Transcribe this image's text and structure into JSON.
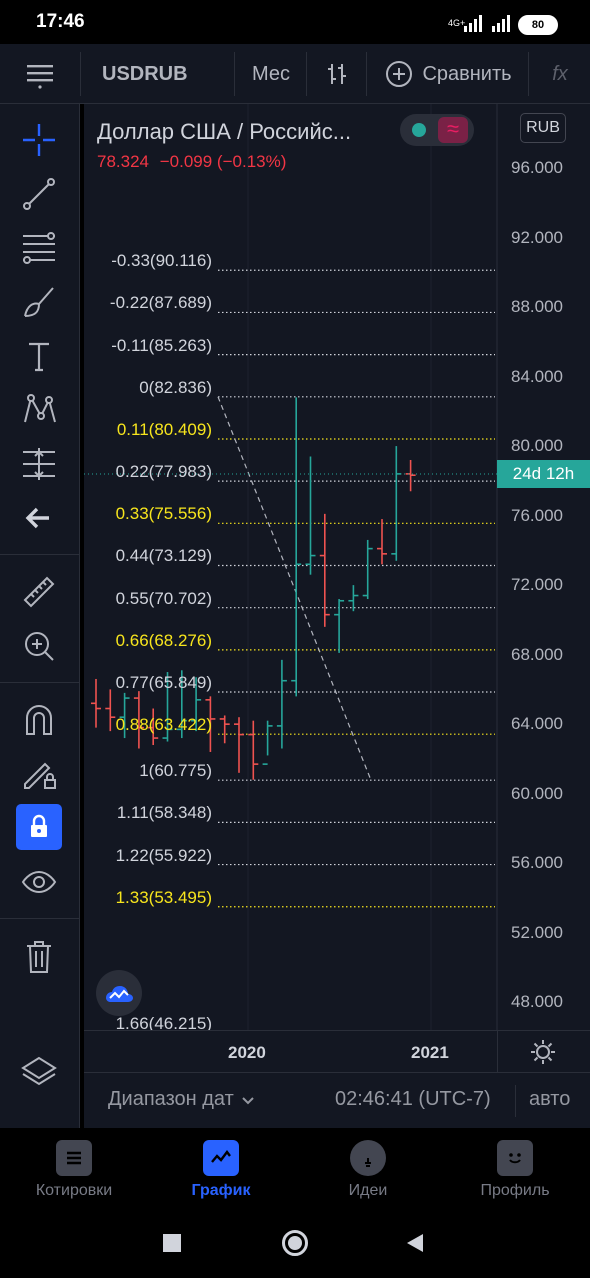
{
  "status_bar": {
    "time": "17:46",
    "network": "4G+",
    "battery": "80"
  },
  "toolbar": {
    "symbol": "USDRUB",
    "interval": "Мес",
    "compare_label": "Сравнить",
    "fx": "fx"
  },
  "chart_header": {
    "title": "Доллар США / Российс...",
    "price": "78.324",
    "change": "−0.099 (−0.13%)",
    "currency": "RUB"
  },
  "price_axis": [
    "96.000",
    "92.000",
    "88.000",
    "84.000",
    "80.000",
    "76.000",
    "72.000",
    "68.000",
    "64.000",
    "60.000",
    "56.000",
    "52.000",
    "48.000"
  ],
  "countdown": "24d 12h",
  "time_axis": [
    "2020",
    "2021"
  ],
  "fib_levels": [
    {
      "label": "-0.33(90.116)",
      "color": "#d1d4dc",
      "y": 90.116
    },
    {
      "label": "-0.22(87.689)",
      "color": "#d1d4dc",
      "y": 87.689
    },
    {
      "label": "-0.11(85.263)",
      "color": "#d1d4dc",
      "y": 85.263
    },
    {
      "label": "0(82.836)",
      "color": "#d1d4dc",
      "y": 82.836
    },
    {
      "label": "0.11(80.409)",
      "color": "#f7e51d",
      "y": 80.409
    },
    {
      "label": "0.22(77.983)",
      "color": "#d1d4dc",
      "y": 77.983
    },
    {
      "label": "0.33(75.556)",
      "color": "#f7e51d",
      "y": 75.556
    },
    {
      "label": "0.44(73.129)",
      "color": "#d1d4dc",
      "y": 73.129
    },
    {
      "label": "0.55(70.702)",
      "color": "#d1d4dc",
      "y": 70.702
    },
    {
      "label": "0.66(68.276)",
      "color": "#f7e51d",
      "y": 68.276
    },
    {
      "label": "0.77(65.849)",
      "color": "#d1d4dc",
      "y": 65.849
    },
    {
      "label": "0.88(63.422)",
      "color": "#f7e51d",
      "y": 63.422
    },
    {
      "label": "1(60.775)",
      "color": "#d1d4dc",
      "y": 60.775
    },
    {
      "label": "1.11(58.348)",
      "color": "#d1d4dc",
      "y": 58.348
    },
    {
      "label": "1.22(55.922)",
      "color": "#d1d4dc",
      "y": 55.922
    },
    {
      "label": "1.33(53.495)",
      "color": "#f7e51d",
      "y": 53.495
    },
    {
      "label": "1.66(46.215)",
      "color": "#d1d4dc",
      "y": 46.215
    }
  ],
  "bars": [
    {
      "o": 65.2,
      "h": 66.6,
      "l": 63.8,
      "c": 64.9
    },
    {
      "o": 64.9,
      "h": 66.0,
      "l": 63.6,
      "c": 64.4
    },
    {
      "o": 64.4,
      "h": 65.8,
      "l": 63.2,
      "c": 65.5
    },
    {
      "o": 65.5,
      "h": 65.9,
      "l": 62.6,
      "c": 63.8
    },
    {
      "o": 63.8,
      "h": 64.9,
      "l": 62.8,
      "c": 63.2
    },
    {
      "o": 63.2,
      "h": 67.0,
      "l": 63.0,
      "c": 63.7
    },
    {
      "o": 63.7,
      "h": 67.1,
      "l": 63.2,
      "c": 64.2
    },
    {
      "o": 64.2,
      "h": 66.7,
      "l": 63.6,
      "c": 65.4
    },
    {
      "o": 65.4,
      "h": 65.6,
      "l": 62.4,
      "c": 64.3
    },
    {
      "o": 64.3,
      "h": 64.5,
      "l": 62.9,
      "c": 64.0
    },
    {
      "o": 64.0,
      "h": 64.4,
      "l": 61.2,
      "c": 63.4
    },
    {
      "o": 63.4,
      "h": 64.2,
      "l": 60.8,
      "c": 61.7
    },
    {
      "o": 61.7,
      "h": 64.2,
      "l": 62.2,
      "c": 63.9
    },
    {
      "o": 63.9,
      "h": 67.7,
      "l": 62.6,
      "c": 66.5
    },
    {
      "o": 66.5,
      "h": 82.8,
      "l": 65.6,
      "c": 73.2
    },
    {
      "o": 73.2,
      "h": 79.4,
      "l": 72.6,
      "c": 73.7
    },
    {
      "o": 73.7,
      "h": 76.1,
      "l": 69.6,
      "c": 70.3
    },
    {
      "o": 70.3,
      "h": 71.2,
      "l": 68.1,
      "c": 71.1
    },
    {
      "o": 71.1,
      "h": 72.0,
      "l": 70.5,
      "c": 71.4
    },
    {
      "o": 71.4,
      "h": 74.6,
      "l": 71.2,
      "c": 74.1
    },
    {
      "o": 74.1,
      "h": 75.8,
      "l": 73.2,
      "c": 73.8
    },
    {
      "o": 73.8,
      "h": 80.0,
      "l": 73.4,
      "c": 78.4
    },
    {
      "o": 78.4,
      "h": 79.2,
      "l": 77.4,
      "c": 78.324
    }
  ],
  "range_bar": {
    "date_range": "Диапазон дат",
    "clock": "02:46:41 (UTC-7)",
    "auto": "авто"
  },
  "bottom_nav": [
    {
      "label": "Котировки",
      "icon": "quotes-icon"
    },
    {
      "label": "График",
      "icon": "chart-icon"
    },
    {
      "label": "Идеи",
      "icon": "ideas-icon"
    },
    {
      "label": "Профиль",
      "icon": "profile-icon"
    }
  ],
  "colors": {
    "up": "#26a69a",
    "down": "#ef5350",
    "accent": "#2962ff",
    "fib_gold": "#f7e51d",
    "background": "#131722"
  }
}
